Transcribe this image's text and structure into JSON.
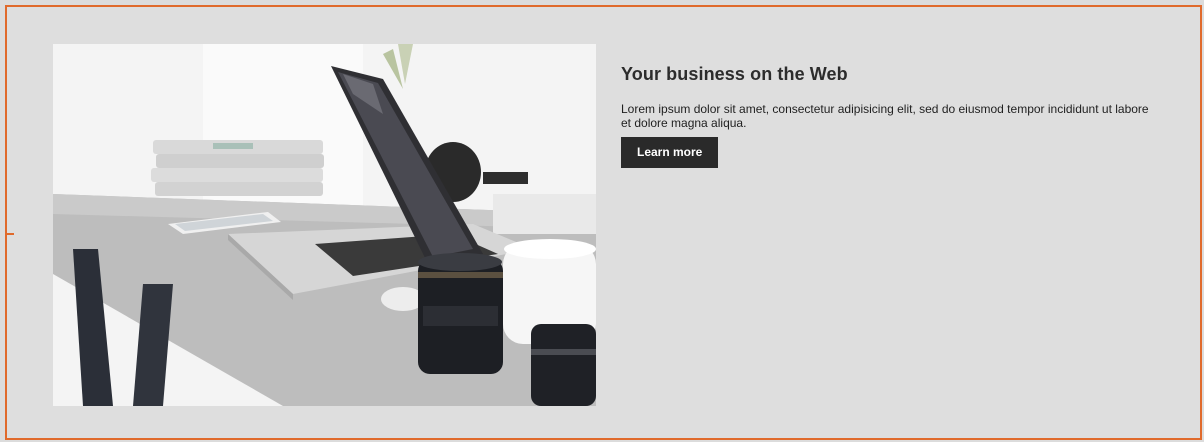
{
  "hero": {
    "title": "Your business on the Web",
    "description": "Lorem ipsum dolor sit amet, consectetur adipisicing elit, sed do eiusmod tempor incididunt ut labore et dolore magna aliqua.",
    "cta_label": "Learn more"
  },
  "theme": {
    "border_color": "#e06a2c",
    "background": "#dedede",
    "button_bg": "#2a2a2a",
    "button_text": "#ffffff"
  },
  "media": {
    "icon": "laptop-desk-photo"
  }
}
